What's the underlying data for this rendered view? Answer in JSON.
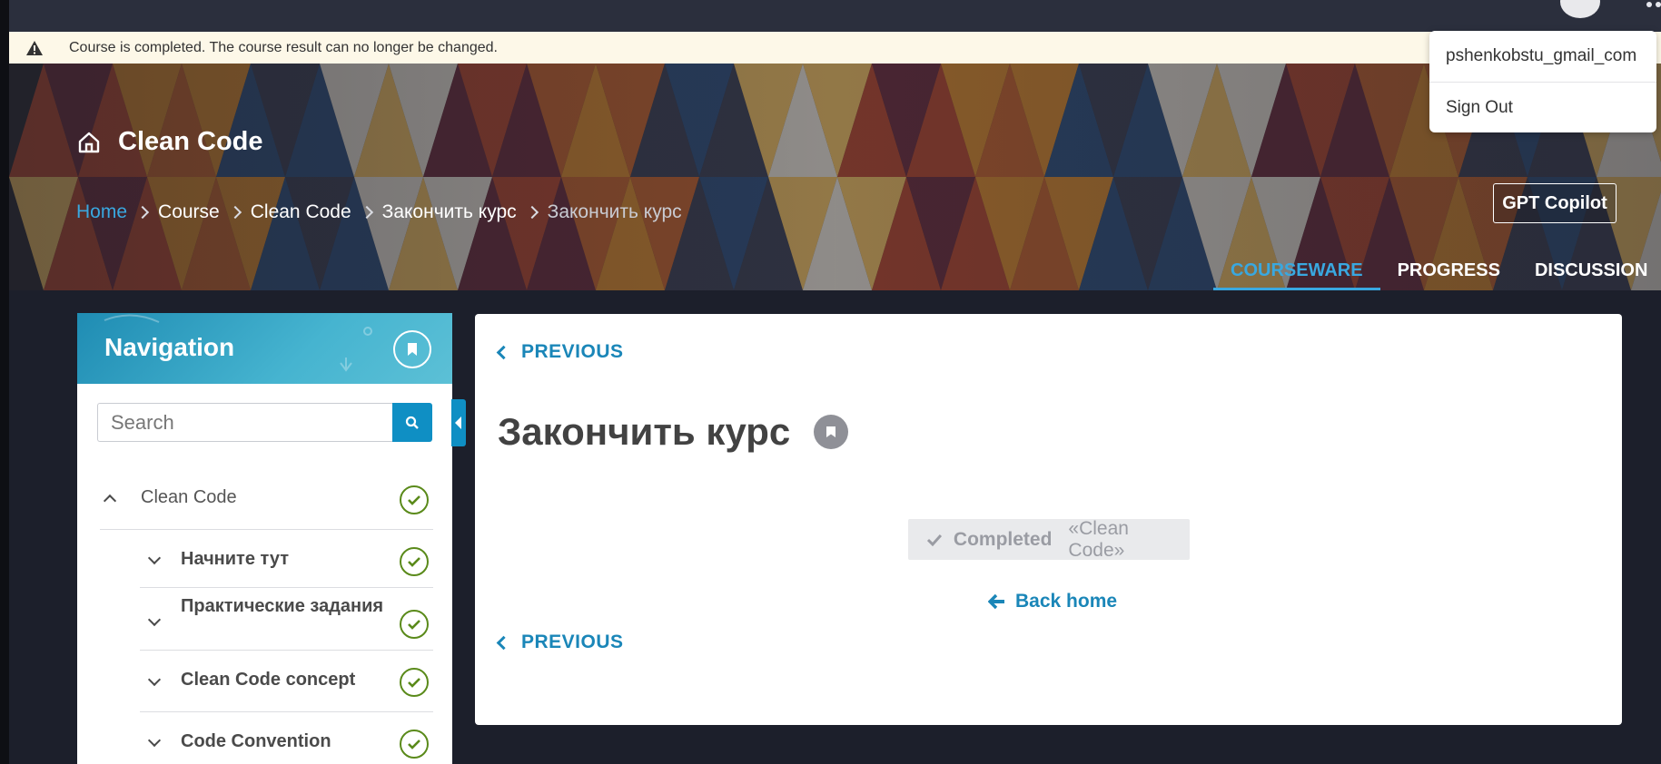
{
  "alert": {
    "text": "Course is completed. The course result can no longer be changed."
  },
  "user_menu": {
    "username": "pshenkobstu_gmail_com",
    "sign_out": "Sign Out"
  },
  "course": {
    "title": "Clean Code"
  },
  "breadcrumb": [
    "Home",
    "Course",
    "Clean Code",
    "Закончить курс",
    "Закончить курс"
  ],
  "gpt_copilot": "GPT Copilot",
  "tabs": [
    "COURSEWARE",
    "PROGRESS",
    "DISCUSSION"
  ],
  "active_tab": "COURSEWARE",
  "navigation": {
    "title": "Navigation",
    "search_placeholder": "Search",
    "items": [
      {
        "label": "Clean Code",
        "level": 0,
        "expanded": true,
        "completed": true
      },
      {
        "label": "Начните тут",
        "level": 1,
        "expanded": false,
        "completed": true
      },
      {
        "label": "Практические задания",
        "level": 1,
        "expanded": false,
        "completed": true
      },
      {
        "label": "Clean Code concept",
        "level": 1,
        "expanded": false,
        "completed": true
      },
      {
        "label": "Code Convention",
        "level": 1,
        "expanded": false,
        "completed": true
      }
    ]
  },
  "content": {
    "previous_top": "PREVIOUS",
    "unit_title": "Закончить курс",
    "completed_label": "Completed",
    "completed_course": "«Clean Code»",
    "back_home": "Back home",
    "previous_bottom": "PREVIOUS"
  },
  "colors": {
    "accent": "#39a8e0",
    "link": "#1a86b8",
    "success": "#5a8a1a",
    "alert_bg": "#fdf8e8"
  }
}
